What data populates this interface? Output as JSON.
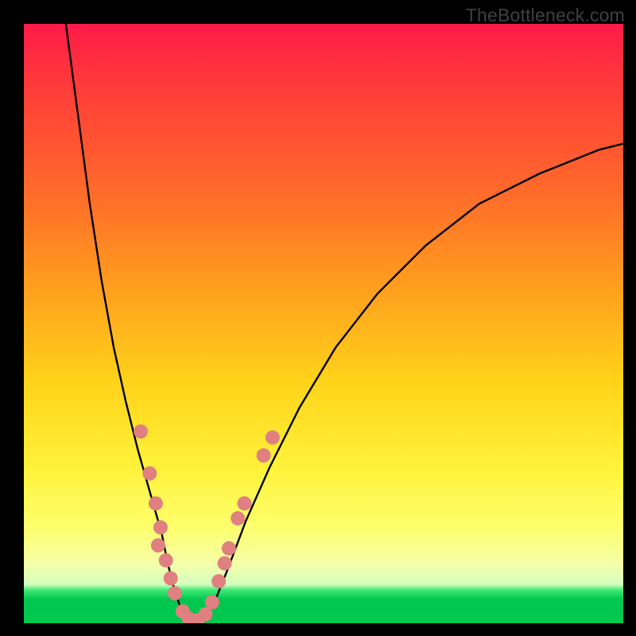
{
  "watermark": "TheBottleneck.com",
  "chart_data": {
    "type": "line",
    "title": "",
    "xlabel": "",
    "ylabel": "",
    "xlim": [
      0,
      100
    ],
    "ylim": [
      0,
      100
    ],
    "curve": {
      "description": "Approximate bottleneck-percentage V-curve. y is bottleneck % (0=green band at bottom, 100=top red). x is normalized horizontal position 0–100.",
      "points": [
        {
          "x": 7,
          "y": 100
        },
        {
          "x": 9,
          "y": 85
        },
        {
          "x": 11,
          "y": 70
        },
        {
          "x": 13,
          "y": 57
        },
        {
          "x": 15,
          "y": 46
        },
        {
          "x": 17,
          "y": 37
        },
        {
          "x": 19,
          "y": 29
        },
        {
          "x": 21,
          "y": 22
        },
        {
          "x": 23,
          "y": 15
        },
        {
          "x": 24,
          "y": 10
        },
        {
          "x": 25,
          "y": 6
        },
        {
          "x": 26,
          "y": 3
        },
        {
          "x": 27,
          "y": 1
        },
        {
          "x": 28,
          "y": 0
        },
        {
          "x": 29,
          "y": 0
        },
        {
          "x": 30,
          "y": 1
        },
        {
          "x": 32,
          "y": 4
        },
        {
          "x": 34,
          "y": 9
        },
        {
          "x": 37,
          "y": 17
        },
        {
          "x": 41,
          "y": 26
        },
        {
          "x": 46,
          "y": 36
        },
        {
          "x": 52,
          "y": 46
        },
        {
          "x": 59,
          "y": 55
        },
        {
          "x": 67,
          "y": 63
        },
        {
          "x": 76,
          "y": 70
        },
        {
          "x": 86,
          "y": 75
        },
        {
          "x": 96,
          "y": 79
        },
        {
          "x": 100,
          "y": 80
        }
      ]
    },
    "markers": {
      "description": "Salmon-pink dot markers clustered around the valley of the curve.",
      "color": "#e08080",
      "radius": 9,
      "points": [
        {
          "x": 19.5,
          "y": 32
        },
        {
          "x": 21.0,
          "y": 25
        },
        {
          "x": 22.0,
          "y": 20
        },
        {
          "x": 22.8,
          "y": 16
        },
        {
          "x": 22.4,
          "y": 13
        },
        {
          "x": 23.7,
          "y": 10.5
        },
        {
          "x": 24.5,
          "y": 7.5
        },
        {
          "x": 25.2,
          "y": 5
        },
        {
          "x": 26.5,
          "y": 2
        },
        {
          "x": 27.5,
          "y": 0.8
        },
        {
          "x": 29.0,
          "y": 0.5
        },
        {
          "x": 30.3,
          "y": 1.5
        },
        {
          "x": 31.4,
          "y": 3.5
        },
        {
          "x": 32.5,
          "y": 7
        },
        {
          "x": 33.5,
          "y": 10
        },
        {
          "x": 34.2,
          "y": 12.5
        },
        {
          "x": 35.7,
          "y": 17.5
        },
        {
          "x": 36.8,
          "y": 20
        },
        {
          "x": 40.0,
          "y": 28
        },
        {
          "x": 41.5,
          "y": 31
        }
      ]
    }
  }
}
